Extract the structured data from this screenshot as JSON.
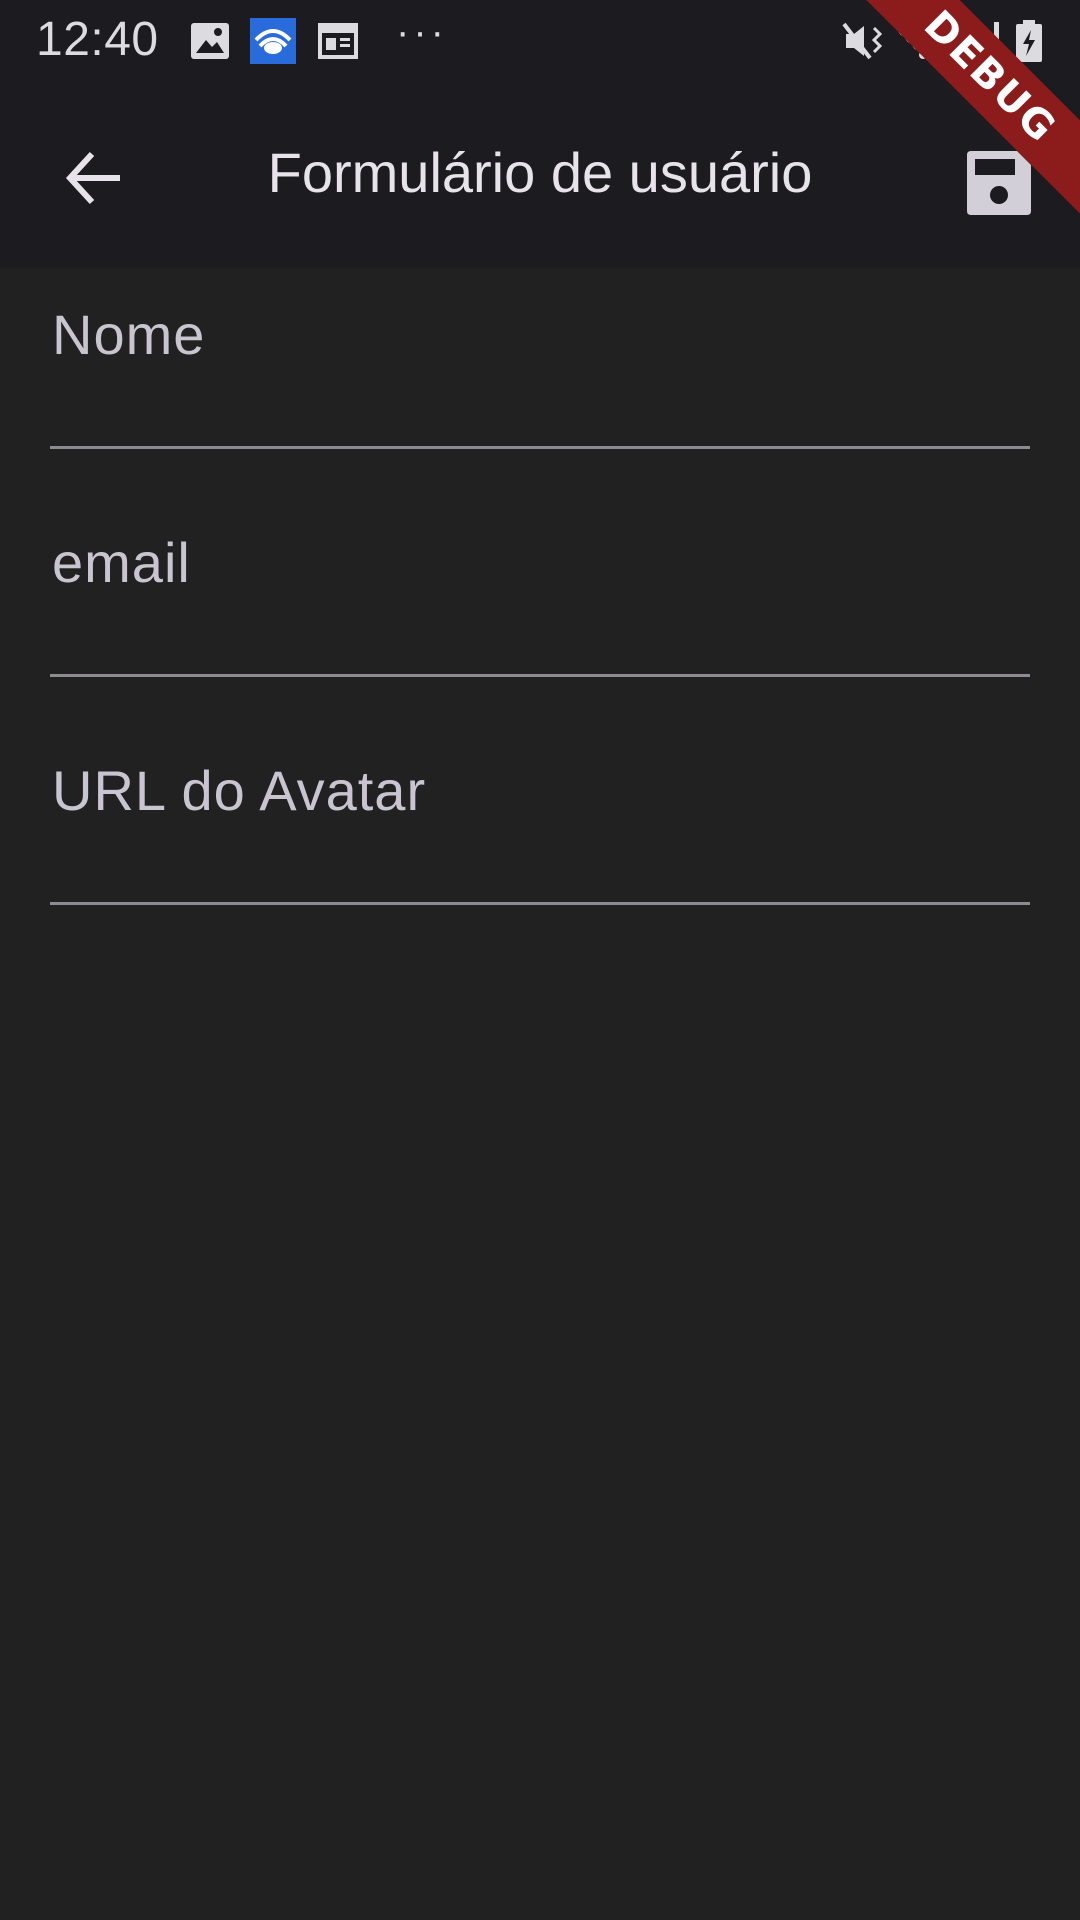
{
  "status_bar": {
    "time": "12:40",
    "dots": "···",
    "icons": [
      "image-icon",
      "app-icon",
      "news-icon",
      "mute-icon",
      "wifi-icon",
      "signal-icon",
      "battery-charging-icon"
    ]
  },
  "debug_banner": "DEBUG",
  "app_bar": {
    "title": "Formulário de usuário",
    "back_icon": "arrow-back-icon",
    "save_icon": "save-icon"
  },
  "form": {
    "fields": [
      {
        "label": "Nome",
        "value": ""
      },
      {
        "label": "email",
        "value": ""
      },
      {
        "label": "URL do Avatar",
        "value": ""
      }
    ]
  },
  "colors": {
    "background": "#212121",
    "app_bar": "#1c1b20",
    "text": "#e6e3ea",
    "label": "#c9c5d0",
    "underline": "#8d8a92",
    "debug": "#8c1b1b"
  }
}
